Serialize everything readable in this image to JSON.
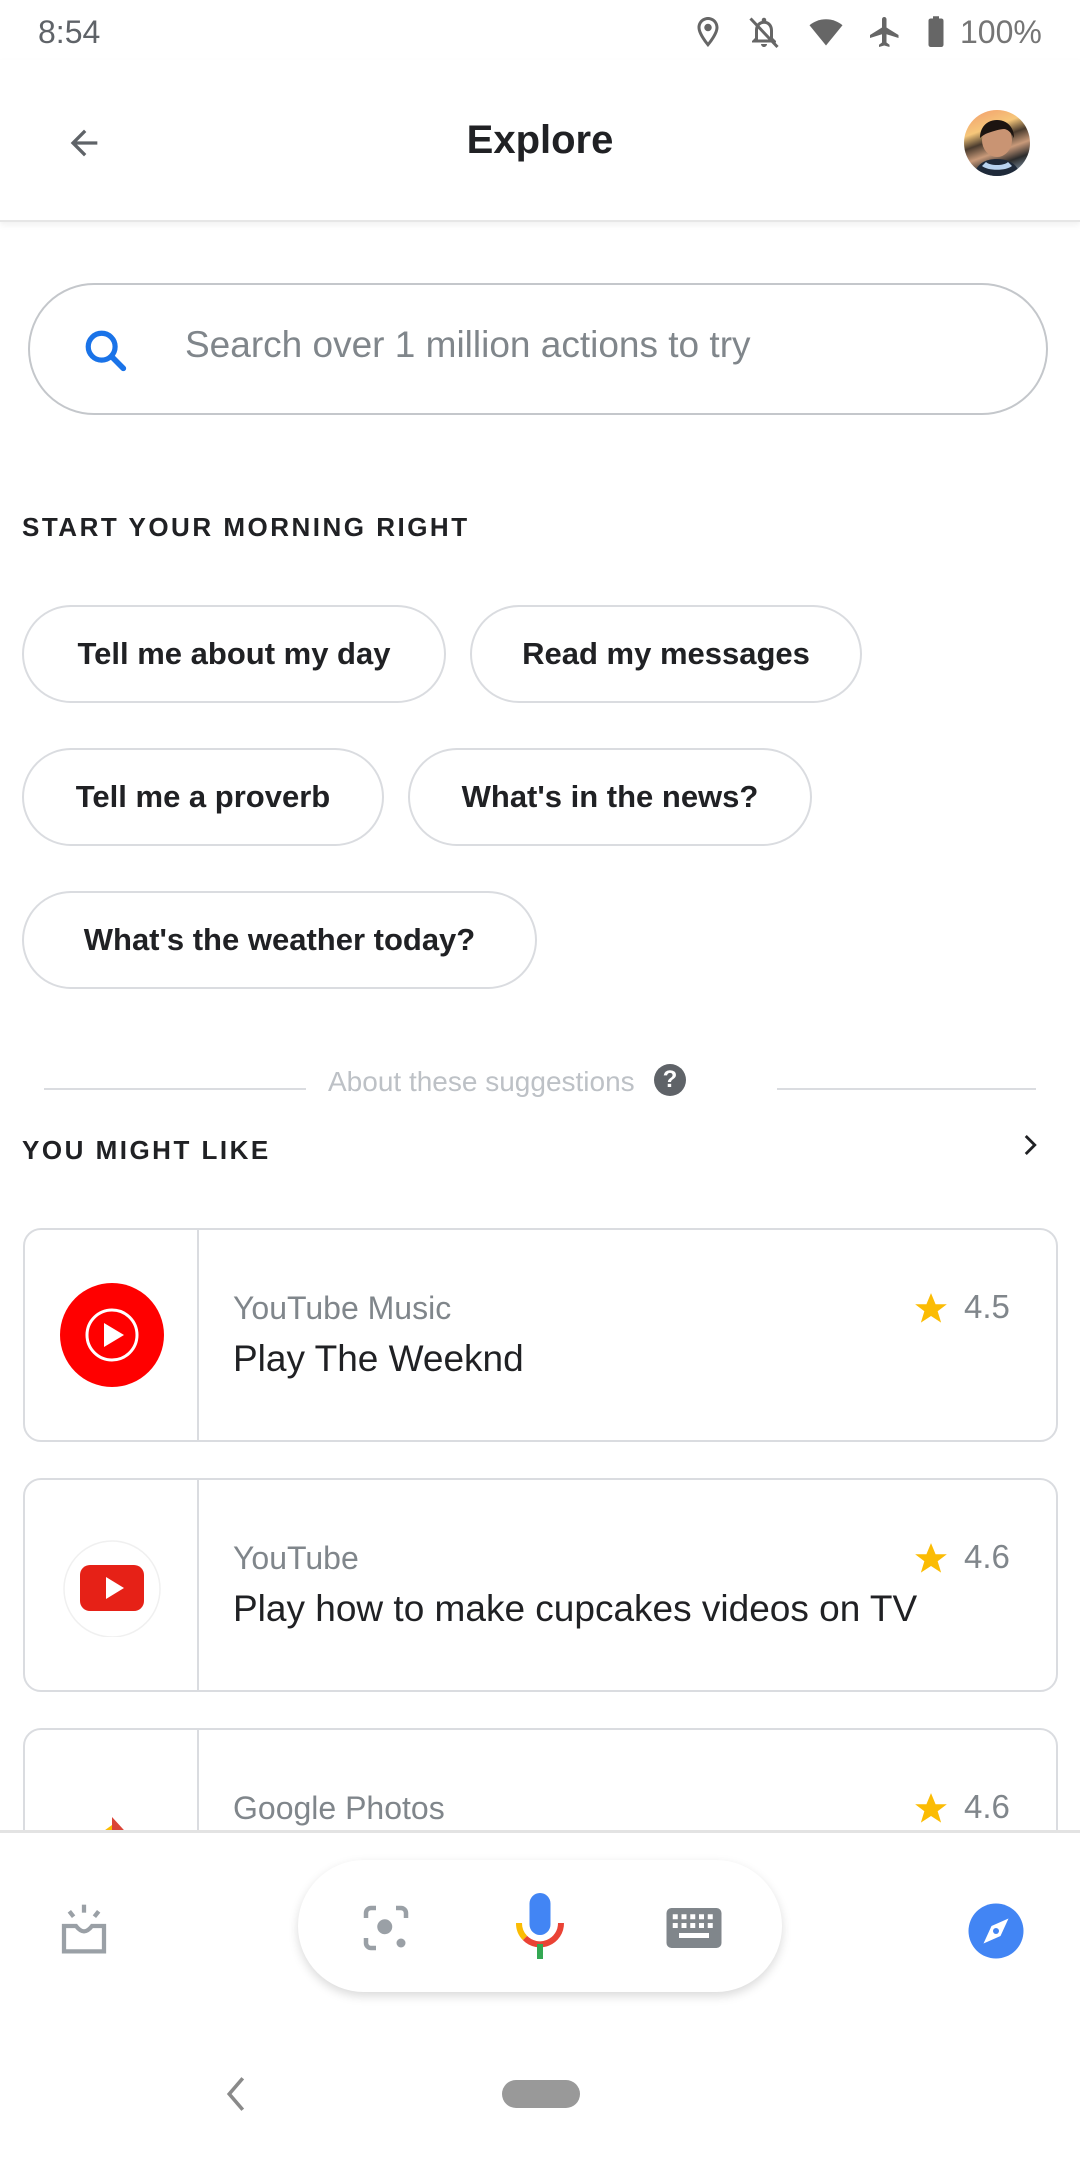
{
  "status_bar": {
    "time": "8:54",
    "battery_percent": "100%",
    "icons": [
      "location-icon",
      "bell-off-icon",
      "wifi-icon",
      "airplane-icon",
      "battery-icon"
    ]
  },
  "header": {
    "title": "Explore",
    "back_icon": "arrow-left-icon",
    "avatar": "user-avatar"
  },
  "search": {
    "placeholder": "Search over 1 million actions to try",
    "value": ""
  },
  "morning_section": {
    "heading": "START YOUR MORNING RIGHT",
    "chips": [
      {
        "label": "Tell me about my day"
      },
      {
        "label": "Read my messages"
      },
      {
        "label": "Tell me a proverb"
      },
      {
        "label": "What's in the news?"
      },
      {
        "label": "What's the weather today?"
      }
    ]
  },
  "about": {
    "label": "About these suggestions",
    "help_glyph": "?"
  },
  "might_like": {
    "heading": "YOU MIGHT LIKE",
    "cards": [
      {
        "app": "YouTube Music",
        "action": "Play The Weeknd",
        "rating": "4.5",
        "icon": "youtube-music-icon"
      },
      {
        "app": "YouTube",
        "action": "Play how to make cupcakes videos on TV",
        "rating": "4.6",
        "icon": "youtube-icon"
      },
      {
        "app": "Google Photos",
        "action": "",
        "rating": "4.6",
        "icon": "google-photos-icon"
      }
    ]
  },
  "bottom_bar": {
    "items": [
      "updates-icon",
      "lens-icon",
      "microphone-icon",
      "keyboard-icon",
      "explore-compass-icon"
    ],
    "accent_color": "#4285F4"
  },
  "colors": {
    "brand_blue": "#1a73e8",
    "star": "#fbbc04",
    "youtube_red": "#ff0000"
  }
}
